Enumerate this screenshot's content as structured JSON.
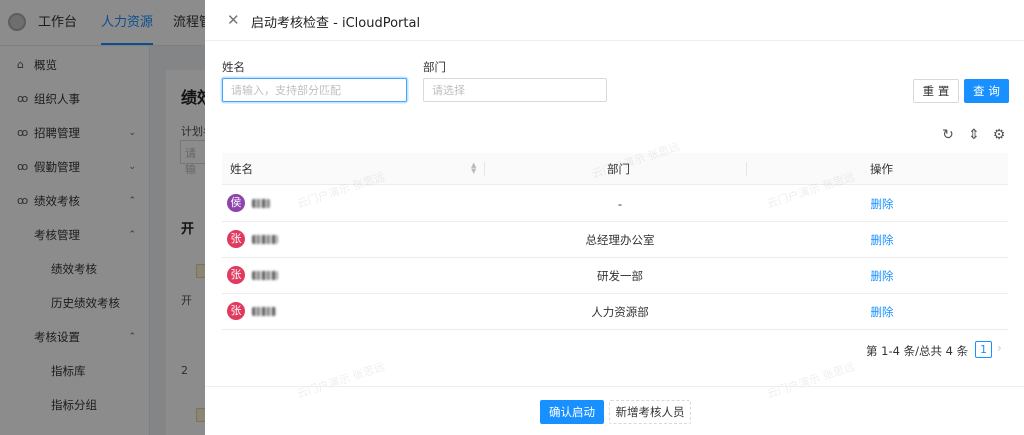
{
  "app": {
    "top_nav": [
      {
        "label": "工作台",
        "active": false
      },
      {
        "label": "人力资源",
        "active": true
      },
      {
        "label": "流程管"
      }
    ],
    "sidebar": {
      "items": [
        {
          "label": "概览",
          "icon": "home-icon"
        },
        {
          "label": "组织人事",
          "icon": "people-icon"
        },
        {
          "label": "招聘管理",
          "icon": "people-icon",
          "chevron": "down"
        },
        {
          "label": "假勤管理",
          "icon": "people-icon",
          "chevron": "down"
        },
        {
          "label": "绩效考核",
          "icon": "people-icon",
          "chevron": "up"
        },
        {
          "label": "考核管理",
          "chevron": "up"
        },
        {
          "label": "绩效考核"
        },
        {
          "label": "历史绩效考核"
        },
        {
          "label": "考核设置",
          "chevron": "up"
        },
        {
          "label": "指标库"
        },
        {
          "label": "指标分组"
        }
      ]
    },
    "background_page": {
      "title": "绩效",
      "plan_label": "计划名",
      "input_placeholder": "请输",
      "text_a": "开",
      "text_b": "开",
      "text_c": "2"
    }
  },
  "drawer": {
    "title": "启动考核检查 - iCloudPortal",
    "filters": {
      "name_label": "姓名",
      "name_placeholder": "请输入，支持部分匹配",
      "dept_label": "部门",
      "dept_placeholder": "请选择"
    },
    "reset_label": "重 置",
    "query_label": "查 询",
    "table": {
      "columns": [
        "姓名",
        "部门",
        "操作"
      ],
      "rows": [
        {
          "avatar_char": "侯",
          "avatar_color": "#8e44ad",
          "dept": "-",
          "action": "删除"
        },
        {
          "avatar_char": "张",
          "avatar_color": "#e03a5f",
          "dept": "总经理办公室",
          "action": "删除"
        },
        {
          "avatar_char": "张",
          "avatar_color": "#e03a5f",
          "dept": "研发一部",
          "action": "删除"
        },
        {
          "avatar_char": "张",
          "avatar_color": "#e03a5f",
          "dept": "人力资源部",
          "action": "删除"
        }
      ]
    },
    "pagination": {
      "summary": "第 1-4 条/总共 4 条",
      "current_page": "1"
    },
    "footer": {
      "confirm_label": "确认启动",
      "add_label": "新增考核人员"
    },
    "watermark": "云门户演示 张思远"
  }
}
